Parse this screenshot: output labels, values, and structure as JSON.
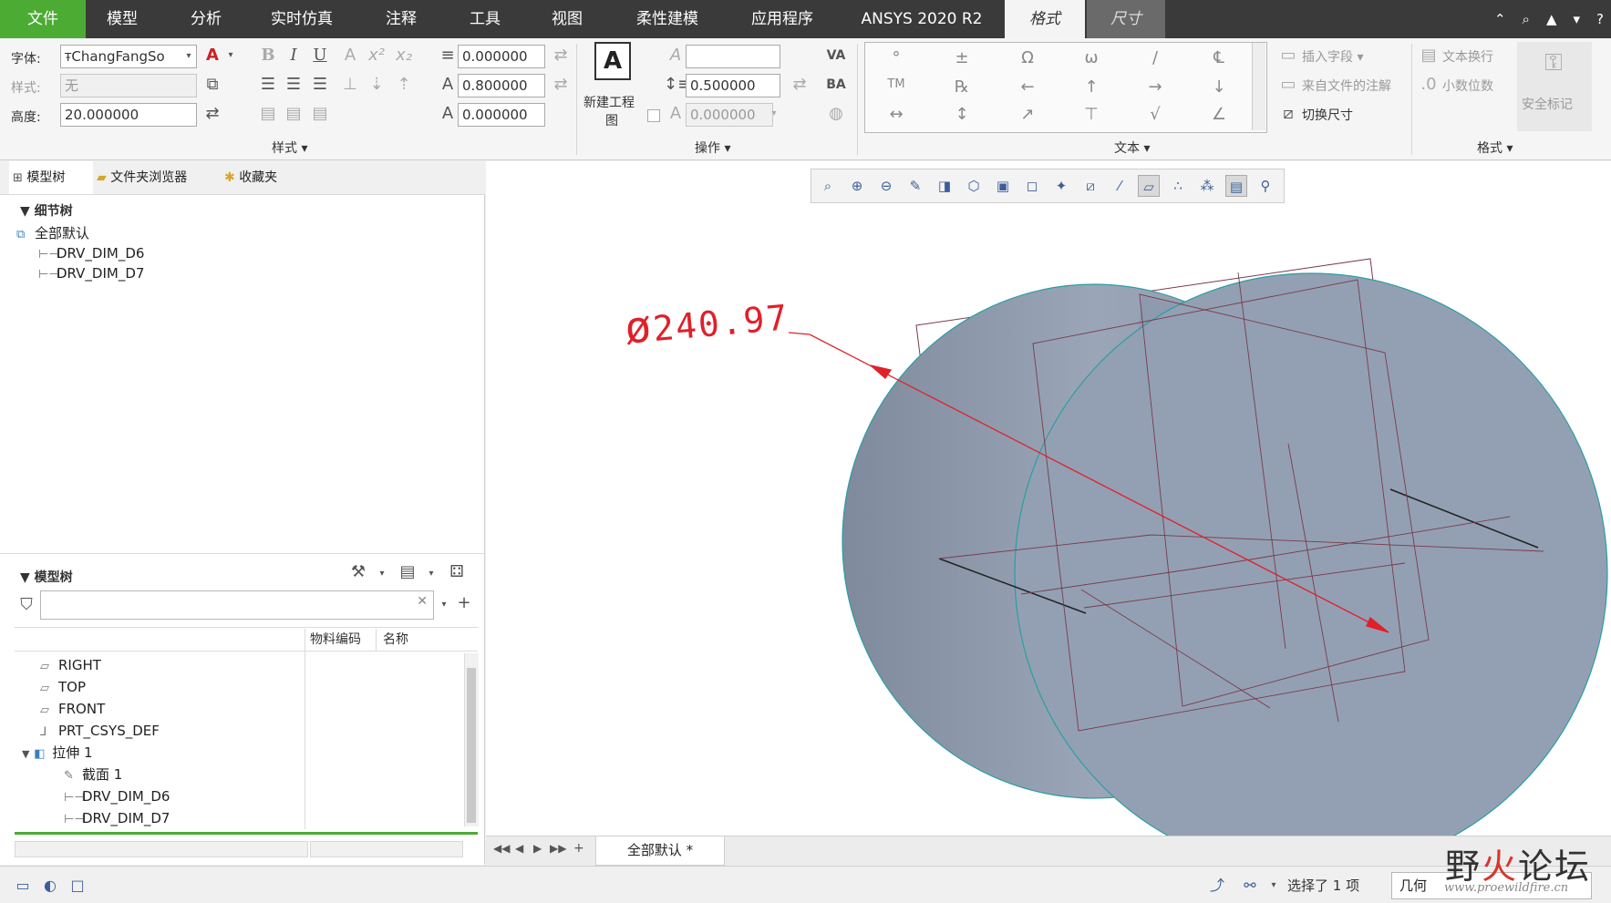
{
  "menubar": {
    "items": [
      "文件",
      "模型",
      "分析",
      "实时仿真",
      "注释",
      "工具",
      "视图",
      "柔性建模",
      "应用程序",
      "ANSYS 2020 R2",
      "格式",
      "尺寸"
    ]
  },
  "ribbon": {
    "font_label": "字体:",
    "font_value": "ChangFangSo",
    "style_label": "样式:",
    "style_value": "无",
    "height_label": "高度:",
    "height_value": "20.000000",
    "spacing1_value": "0.000000",
    "spacing2_value": "0.800000",
    "spacing3_value": "0.000000",
    "style_group_title": "样式",
    "new_drawing_label_line1": "新建工程",
    "new_drawing_label_line2": "图",
    "line_spacing_value": "0.500000",
    "slant_value": "0.000000",
    "ops_group_title": "操作",
    "text_group_title": "文本",
    "insert_field": "插入字段",
    "from_file_note": "来自文件的注解",
    "toggle_dim": "切换尺寸",
    "text_wrap": "文本换行",
    "decimals": "小数位数",
    "security_mark": "安全标记",
    "format_group_title": "格式",
    "symbols": [
      "°",
      "±",
      "Ω",
      "ω",
      "/",
      "℄",
      "TM",
      "℞",
      "←",
      "↑",
      "→",
      "↓",
      "↔",
      "↕",
      "↗",
      "⊤",
      "√",
      "∠"
    ]
  },
  "leftpanel": {
    "tabs": [
      "模型树",
      "文件夹浏览器",
      "收藏夹"
    ],
    "detail_tree_title": "细节树",
    "detail_root": "全部默认",
    "detail_items": [
      "DRV_DIM_D6",
      "DRV_DIM_D7"
    ],
    "model_tree_title": "模型树",
    "col_part_code": "物料编码",
    "col_name": "名称",
    "model_items": [
      "RIGHT",
      "TOP",
      "FRONT",
      "PRT_CSYS_DEF",
      "拉伸 1",
      "截面 1",
      "DRV_DIM_D6",
      "DRV_DIM_D7"
    ]
  },
  "canvas": {
    "dimension_text": "240.97",
    "dimension_color": "#e0202a"
  },
  "sheetbar": {
    "tab_label": "全部默认 *"
  },
  "statusbar": {
    "selection_text": "选择了 1 项",
    "filter_value": "几何"
  },
  "watermark": {
    "name_part1": "野",
    "name_part2": "火",
    "name_part3": "论坛",
    "url": "www.proewildfire.cn"
  }
}
